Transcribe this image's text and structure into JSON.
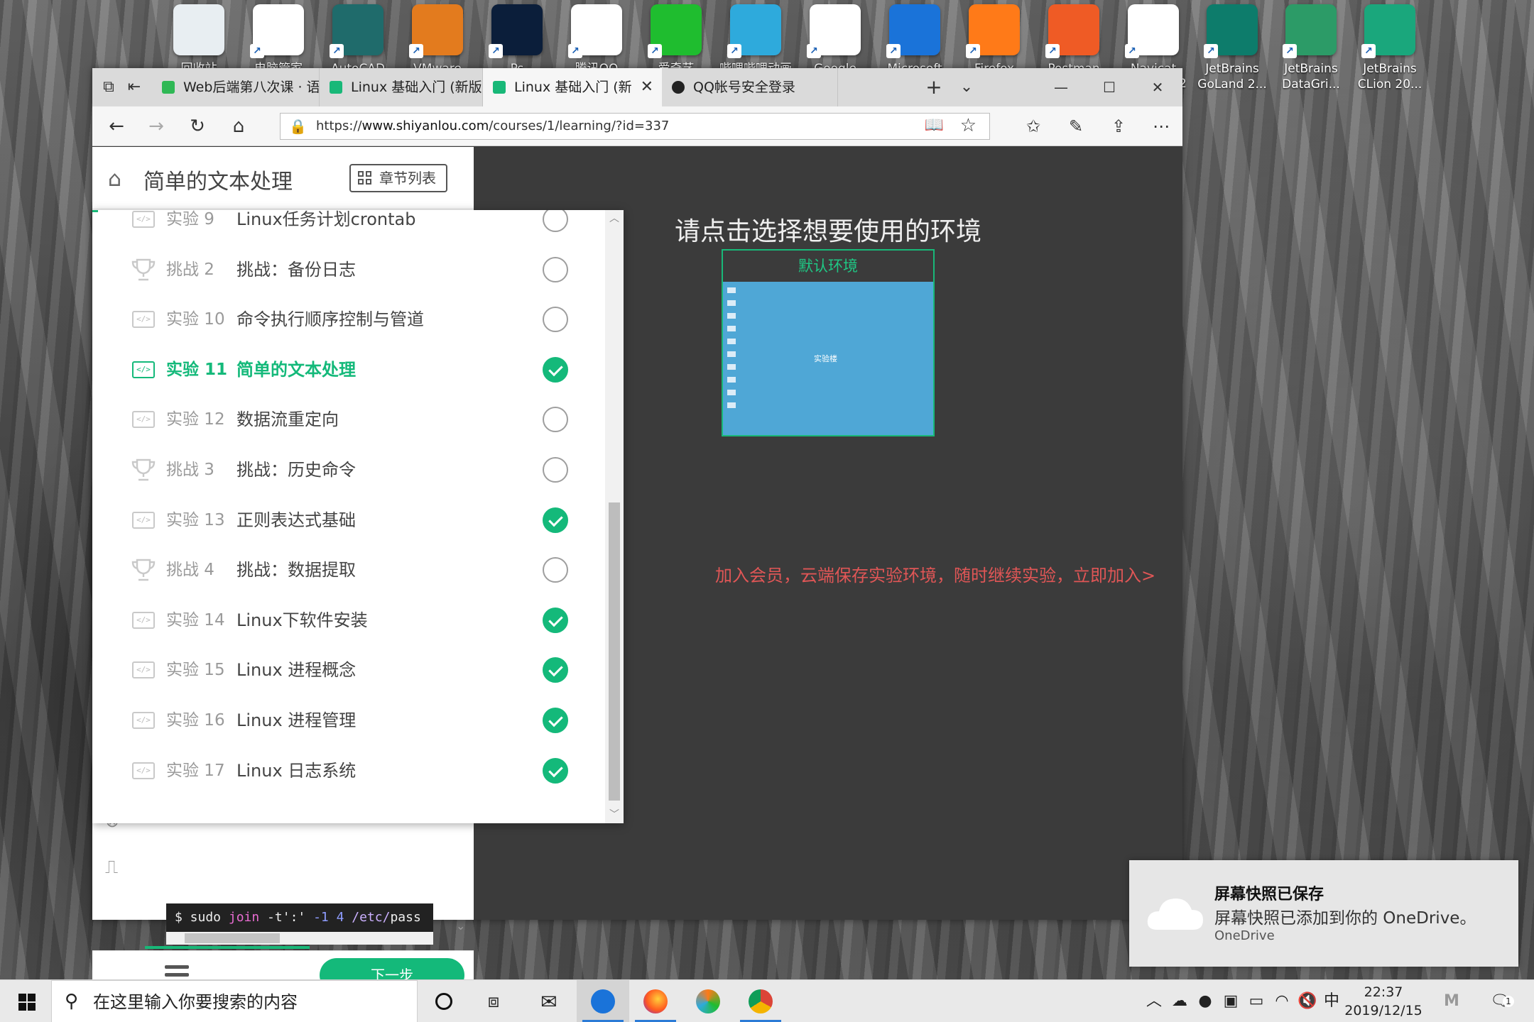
{
  "desktop": {
    "icons": [
      {
        "label": "回收站",
        "icon": "recycle-bin-icon",
        "color": "#e8eef2"
      },
      {
        "label": "电脑管家",
        "icon": "pc-manager-icon",
        "color": "#ffffff"
      },
      {
        "label": "AutoCAD",
        "icon": "autocad-icon",
        "color": "#1f6b6b"
      },
      {
        "label": "VMware",
        "icon": "vmware-icon",
        "color": "#e37b1e"
      },
      {
        "label": "Ps",
        "icon": "photoshop-icon",
        "color": "#0b1e3a"
      },
      {
        "label": "腾讯QQ",
        "icon": "qq-icon",
        "color": "#ffffff"
      },
      {
        "label": "爱奇艺",
        "icon": "iqiyi-icon",
        "color": "#1fbd2f"
      },
      {
        "label": "哔哩哔哩动画",
        "icon": "bilibili-icon",
        "color": "#2eaadc"
      },
      {
        "label": "Google",
        "icon": "chrome-icon",
        "color": "#ffffff"
      },
      {
        "label": "Microsoft",
        "icon": "edge-icon",
        "color": "#1a73d9"
      },
      {
        "label": "Firefox",
        "icon": "firefox-icon",
        "color": "#ff7a18"
      },
      {
        "label": "Postman",
        "icon": "postman-icon",
        "color": "#ef5b25"
      },
      {
        "label": "Navicat",
        "icon": "navicat-icon",
        "color": "#ffffff"
      },
      {
        "label": "JetBrains GoLand 2...",
        "icon": "goland-icon",
        "color": "#0d7c6b"
      },
      {
        "label": "JetBrains DataGri...",
        "icon": "datagrip-icon",
        "color": "#2c9b67"
      },
      {
        "label": "JetBrains CLion 20...",
        "icon": "clion-icon",
        "color": "#1aa77c"
      }
    ],
    "partial_label": "2"
  },
  "browser": {
    "tabs": [
      {
        "label": "Web后端第八次课 · 语雀",
        "active": false,
        "fav_color": "#2fb855"
      },
      {
        "label": "Linux 基础入门 (新版)",
        "active": false,
        "fav_color": "#18b878"
      },
      {
        "label": "Linux 基础入门 (新",
        "active": true,
        "fav_color": "#18b878"
      },
      {
        "label": "QQ帐号安全登录",
        "active": false,
        "fav_color": "#222222"
      }
    ],
    "url_prefix": "https://",
    "url_host": "www.shiyanlou.com",
    "url_path": "/courses/1/learning/?id=337"
  },
  "course": {
    "title": "简单的文本处理",
    "chapter_list_label": "章节列表",
    "next_label": "下一步",
    "code_prompt": "$ sudo ",
    "code_cmd": "join",
    "code_flag": " -t':' ",
    "code_num": "-1 4 ",
    "code_path": "/etc/",
    "code_tail": "pass"
  },
  "chapters": [
    {
      "num": "实验 9",
      "name": "Linux任务计划crontab",
      "type": "lab",
      "done": false,
      "current": false
    },
    {
      "num": "挑战 2",
      "name": "挑战：备份日志",
      "type": "challenge",
      "done": false,
      "current": false
    },
    {
      "num": "实验 10",
      "name": "命令执行顺序控制与管道",
      "type": "lab",
      "done": false,
      "current": false
    },
    {
      "num": "实验 11",
      "name": "简单的文本处理",
      "type": "lab",
      "done": true,
      "current": true
    },
    {
      "num": "实验 12",
      "name": "数据流重定向",
      "type": "lab",
      "done": false,
      "current": false
    },
    {
      "num": "挑战 3",
      "name": "挑战：历史命令",
      "type": "challenge",
      "done": false,
      "current": false
    },
    {
      "num": "实验 13",
      "name": "正则表达式基础",
      "type": "lab",
      "done": true,
      "current": false
    },
    {
      "num": "挑战 4",
      "name": "挑战：数据提取",
      "type": "challenge",
      "done": false,
      "current": false
    },
    {
      "num": "实验 14",
      "name": "Linux下软件安装",
      "type": "lab",
      "done": true,
      "current": false
    },
    {
      "num": "实验 15",
      "name": "Linux 进程概念",
      "type": "lab",
      "done": true,
      "current": false
    },
    {
      "num": "实验 16",
      "name": "Linux 进程管理",
      "type": "lab",
      "done": true,
      "current": false
    },
    {
      "num": "实验 17",
      "name": "Linux 日志系统",
      "type": "lab",
      "done": true,
      "current": false
    }
  ],
  "environment": {
    "prompt": "请点击选择想要使用的环境",
    "default_env": "默认环境",
    "logo_text": "实验楼",
    "promo": "加入会员，云端保存实验环境，随时继续实验，立即加入>"
  },
  "toast": {
    "title": "屏幕快照已保存",
    "message": "屏幕快照已添加到你的 OneDrive。",
    "source": "OneDrive"
  },
  "taskbar": {
    "search_placeholder": "在这里输入你要搜索的内容",
    "ime": "中",
    "time": "22:37",
    "date": "2019/12/15",
    "notifications": "1"
  }
}
